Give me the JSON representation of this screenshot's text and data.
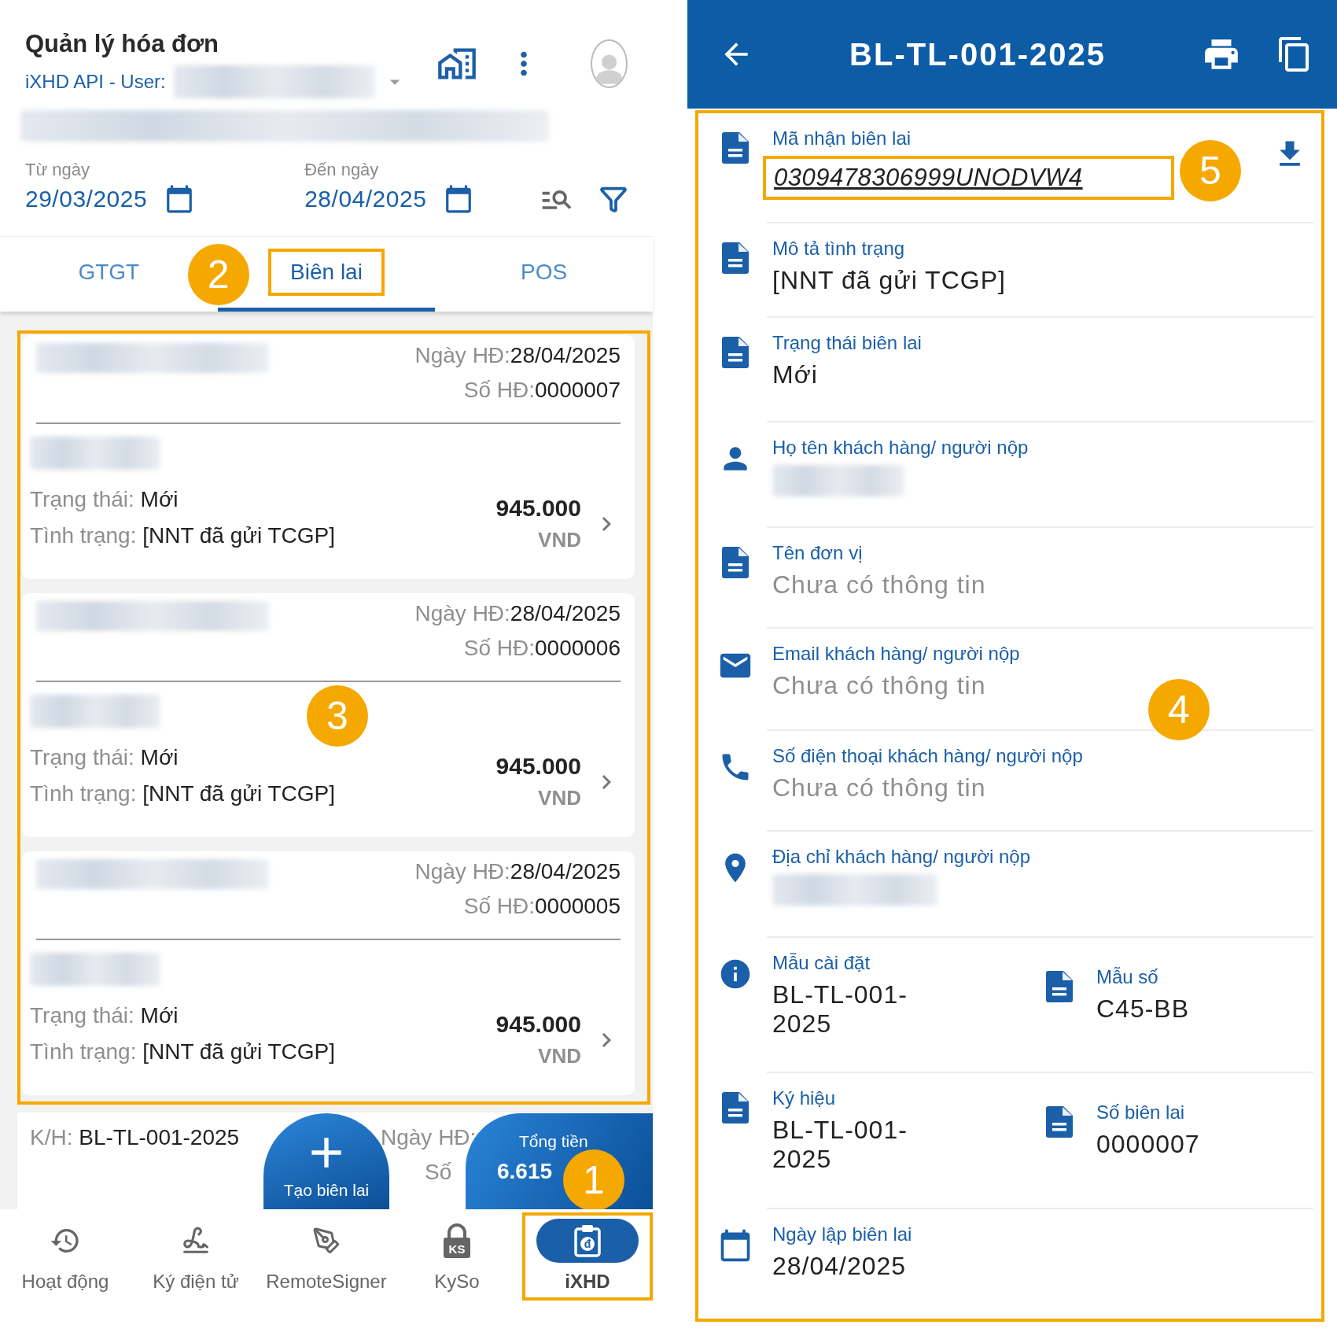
{
  "app_header": {
    "title": "Quản lý hóa đơn",
    "user_label": "iXHD API - User:"
  },
  "date_filter": [
    {
      "label": "Từ ngày",
      "value": "29/03/2025"
    },
    {
      "label": "Đến ngày",
      "value": "28/04/2025"
    }
  ],
  "tabs": [
    {
      "label": "GTGT",
      "selected": false
    },
    {
      "label": "Biên lai",
      "selected": true
    },
    {
      "label": "POS",
      "selected": false
    }
  ],
  "invoices": [
    {
      "date_label": "Ngày HĐ:",
      "date": "28/04/2025",
      "number_label": "Số HĐ:",
      "number": "0000007",
      "status_label": "Trạng thái:",
      "status": "Mới",
      "condition_label": "Tình trạng:",
      "condition": "[NNT đã gửi TCGP]",
      "amount": "945.000",
      "currency": "VND"
    },
    {
      "date_label": "Ngày HĐ:",
      "date": "28/04/2025",
      "number_label": "Số HĐ:",
      "number": "0000006",
      "status_label": "Trạng thái:",
      "status": "Mới",
      "condition_label": "Tình trạng:",
      "condition": "[NNT đã gửi TCGP]",
      "amount": "945.000",
      "currency": "VND"
    },
    {
      "date_label": "Ngày HĐ:",
      "date": "28/04/2025",
      "number_label": "Số HĐ:",
      "number": "0000005",
      "status_label": "Trạng thái:",
      "status": "Mới",
      "condition_label": "Tình trạng:",
      "condition": "[NNT đã gửi TCGP]",
      "amount": "945.000",
      "currency": "VND"
    }
  ],
  "partial_invoice": {
    "symbol_label": "K/H:",
    "symbol": "BL-TL-001-2025",
    "date_label": "Ngày HĐ:",
    "number_label": "Số"
  },
  "create_button": {
    "label": "Tạo biên lai"
  },
  "total": {
    "label": "Tổng tiền",
    "value": "6.615"
  },
  "bottom_nav": [
    {
      "label": "Hoạt động",
      "selected": false
    },
    {
      "label": "Ký điện tử",
      "selected": false
    },
    {
      "label": "RemoteSigner",
      "selected": false
    },
    {
      "label": "KySo",
      "selected": false,
      "icon_text": "KS"
    },
    {
      "label": "iXHD",
      "selected": true,
      "icon_text": "đ"
    }
  ],
  "detail": {
    "title": "BL-TL-001-2025",
    "rows": [
      {
        "fields": [
          {
            "kind": "link",
            "label": "Mã nhận biên lai",
            "value": "0309478306999UNODVW4"
          }
        ]
      },
      {
        "fields": [
          {
            "kind": "text",
            "label": "Mô tả tình trạng",
            "value": "[NNT đã gửi TCGP]"
          }
        ]
      },
      {
        "fields": [
          {
            "kind": "text",
            "label": "Trạng thái biên lai",
            "value": "Mới"
          }
        ]
      },
      {
        "fields": [
          {
            "kind": "redacted",
            "label": "Họ tên khách hàng/ người nộp"
          }
        ]
      },
      {
        "fields": [
          {
            "kind": "missing",
            "label": "Tên đơn vị",
            "value": "Chưa có thông tin"
          }
        ]
      },
      {
        "fields": [
          {
            "kind": "missing",
            "label": "Email khách hàng/ người nộp",
            "value": "Chưa có thông tin"
          }
        ]
      },
      {
        "fields": [
          {
            "kind": "missing",
            "label": "Số điện thoại khách hàng/ người nộp",
            "value": "Chưa có thông tin"
          }
        ]
      },
      {
        "fields": [
          {
            "kind": "redacted",
            "label": "Địa chỉ khách hàng/ người nộp"
          }
        ]
      },
      {
        "fields": [
          {
            "kind": "text",
            "label": "Mẫu cài đặt",
            "value": "BL-TL-001-2025"
          },
          {
            "kind": "text",
            "label": "Mẫu số",
            "value": "C45-BB"
          }
        ]
      },
      {
        "fields": [
          {
            "kind": "text",
            "label": "Ký hiệu",
            "value": "BL-TL-001-2025"
          },
          {
            "kind": "text",
            "label": "Số biên lai",
            "value": "0000007"
          }
        ]
      },
      {
        "fields": [
          {
            "kind": "text",
            "label": "Ngày lập biên lai",
            "value": "28/04/2025"
          }
        ]
      }
    ]
  },
  "callouts": {
    "nav": "1",
    "tabs": "2",
    "list": "3",
    "detail": "4",
    "code": "5"
  }
}
